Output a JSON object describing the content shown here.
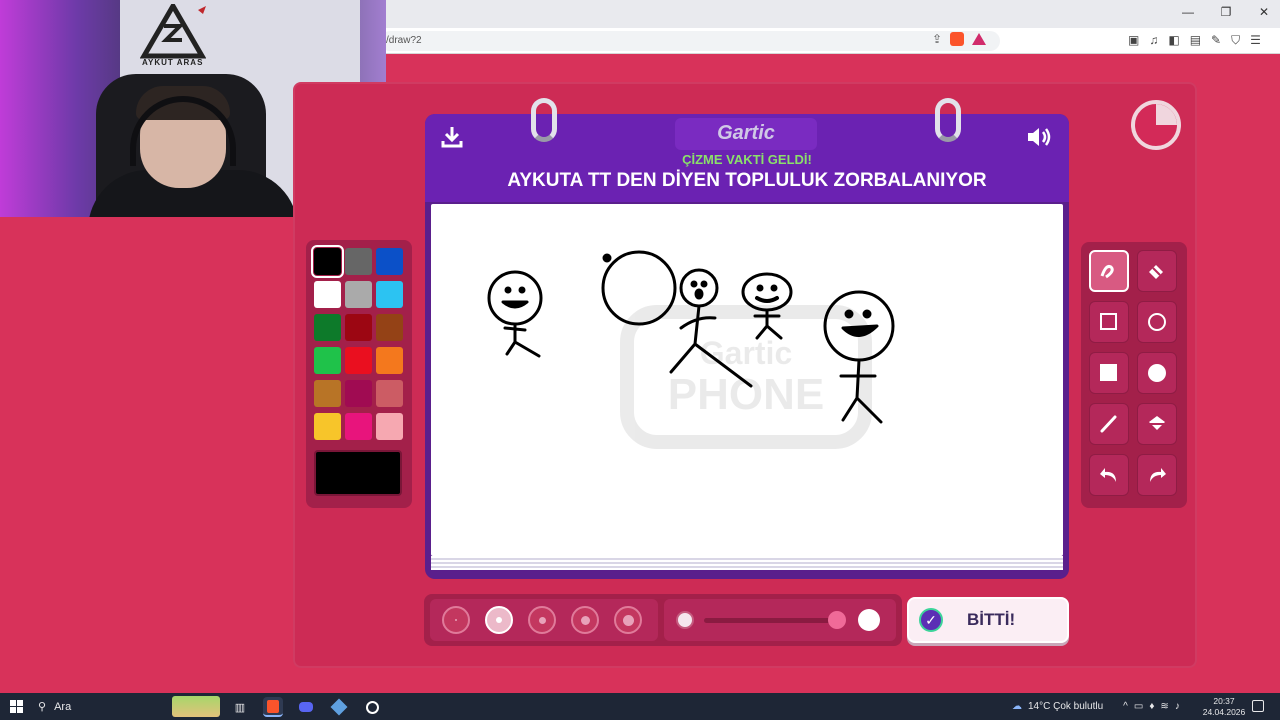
{
  "browser": {
    "url": "/draw?2",
    "window_controls": [
      "—",
      "❐",
      "✕"
    ]
  },
  "webcam": {
    "logo_text": "AYKUT ARAS"
  },
  "game": {
    "brand": "Gartic",
    "subtitle": "ÇİZME VAKTİ GELDİ!",
    "prompt": "AYKUTA TT DEN DİYEN TOPLULUK ZORBALANIYOR",
    "done_label": "BİTTİ!",
    "timer_elapsed_fraction": 0.25,
    "palette": {
      "colors": [
        "#000000",
        "#666666",
        "#0b50c8",
        "#ffffff",
        "#aaaaaa",
        "#2cc3f2",
        "#0d7a2a",
        "#9c0612",
        "#944216",
        "#1fc24a",
        "#ea0f1f",
        "#f4781d",
        "#b87426",
        "#a00b52",
        "#cc5c64",
        "#f7c52a",
        "#e8147c",
        "#f6a8b1"
      ],
      "selected_index": 0,
      "current_color": "#000000"
    },
    "tools": [
      {
        "name": "pen-tool",
        "icon": "pen-icon",
        "active": true
      },
      {
        "name": "eraser-tool",
        "icon": "eraser-icon",
        "active": false
      },
      {
        "name": "rectangle-outline-tool",
        "icon": "square-outline-icon",
        "active": false
      },
      {
        "name": "ellipse-outline-tool",
        "icon": "circle-outline-icon",
        "active": false
      },
      {
        "name": "rectangle-fill-tool",
        "icon": "square-filled-icon",
        "active": false
      },
      {
        "name": "ellipse-fill-tool",
        "icon": "circle-filled-icon",
        "active": false
      },
      {
        "name": "line-tool",
        "icon": "line-icon",
        "active": false
      },
      {
        "name": "fill-bucket-tool",
        "icon": "bucket-icon",
        "active": false
      },
      {
        "name": "undo-tool",
        "icon": "undo-icon",
        "active": false
      },
      {
        "name": "redo-tool",
        "icon": "redo-icon",
        "active": false
      }
    ],
    "brush_sizes": {
      "count": 5,
      "selected_index": 1
    },
    "opacity": 0.85
  },
  "taskbar": {
    "search_label": "Ara",
    "weather": "14°C  Çok bulutlu",
    "time": "20:37",
    "date": "24.04.2026"
  }
}
